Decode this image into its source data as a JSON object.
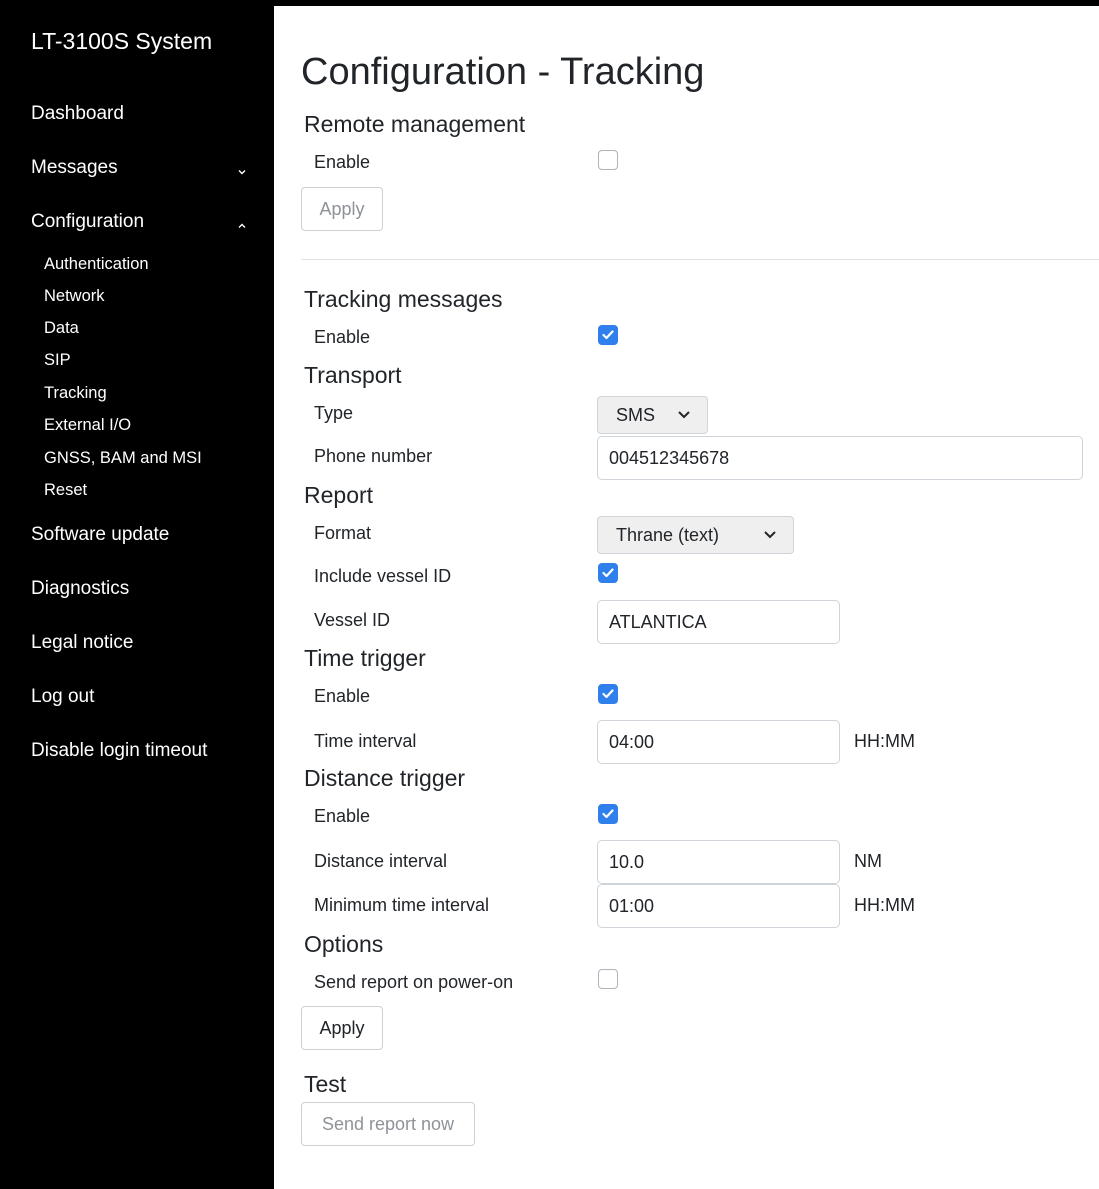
{
  "sidebar": {
    "title": "LT-3100S System",
    "dashboard": "Dashboard",
    "messages": "Messages",
    "configuration": "Configuration",
    "sub_items": [
      "Authentication",
      "Network",
      "Data",
      "SIP",
      "Tracking",
      "External I/O",
      "GNSS, BAM and MSI",
      "Reset"
    ],
    "software_update": "Software update",
    "diagnostics": "Diagnostics",
    "legal_notice": "Legal notice",
    "log_out": "Log out",
    "disable_login_timeout": "Disable login timeout"
  },
  "page": {
    "title": "Configuration - Tracking"
  },
  "remote_management": {
    "heading": "Remote management",
    "enable_label": "Enable",
    "enable_checked": false,
    "apply_label": "Apply"
  },
  "tracking_messages": {
    "heading": "Tracking messages",
    "enable_label": "Enable",
    "enable_checked": true
  },
  "transport": {
    "heading": "Transport",
    "type_label": "Type",
    "type_value": "SMS",
    "phone_label": "Phone number",
    "phone_value": "004512345678"
  },
  "report": {
    "heading": "Report",
    "format_label": "Format",
    "format_value": "Thrane (text)",
    "include_vessel_label": "Include vessel ID",
    "include_vessel_checked": true,
    "vessel_id_label": "Vessel ID",
    "vessel_id_value": "ATLANTICA"
  },
  "time_trigger": {
    "heading": "Time trigger",
    "enable_label": "Enable",
    "enable_checked": true,
    "interval_label": "Time interval",
    "interval_value": "04:00",
    "interval_unit": "HH:MM"
  },
  "distance_trigger": {
    "heading": "Distance trigger",
    "enable_label": "Enable",
    "enable_checked": true,
    "distance_label": "Distance interval",
    "distance_value": "10.0",
    "distance_unit": "NM",
    "min_time_label": "Minimum time interval",
    "min_time_value": "01:00",
    "min_time_unit": "HH:MM"
  },
  "options": {
    "heading": "Options",
    "power_on_label": "Send report on power-on",
    "power_on_checked": false,
    "apply_label": "Apply"
  },
  "test": {
    "heading": "Test",
    "send_label": "Send report now"
  },
  "colors": {
    "sidebar_bg": "#000000",
    "checkbox_on": "#2f80ed"
  }
}
